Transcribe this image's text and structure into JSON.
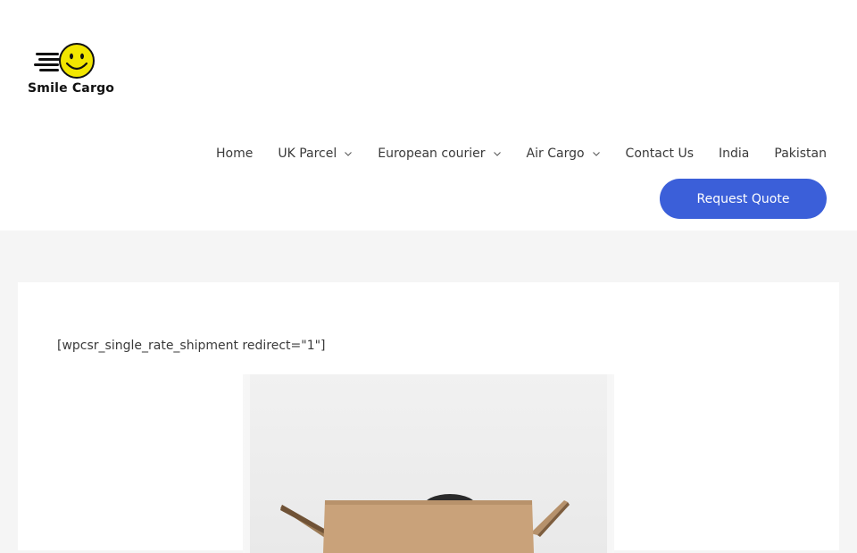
{
  "brand": {
    "name": "Smile Cargo",
    "smiley_color": "#f2e600"
  },
  "nav": {
    "items": [
      {
        "label": "Home",
        "has_dropdown": false
      },
      {
        "label": "UK Parcel",
        "has_dropdown": true
      },
      {
        "label": "European courier",
        "has_dropdown": true
      },
      {
        "label": "Air Cargo",
        "has_dropdown": true
      },
      {
        "label": "Contact Us",
        "has_dropdown": false
      },
      {
        "label": "India",
        "has_dropdown": false
      },
      {
        "label": "Pakistan",
        "has_dropdown": false
      }
    ],
    "cta_label": "Request Quote"
  },
  "content": {
    "shortcode": "[wpcsr_single_rate_shipment redirect=\"1\"]",
    "image_icon": "person-in-cardboard-box-photo"
  },
  "colors": {
    "accent": "#3b5fd9",
    "page_bg": "#f5f5f5"
  }
}
